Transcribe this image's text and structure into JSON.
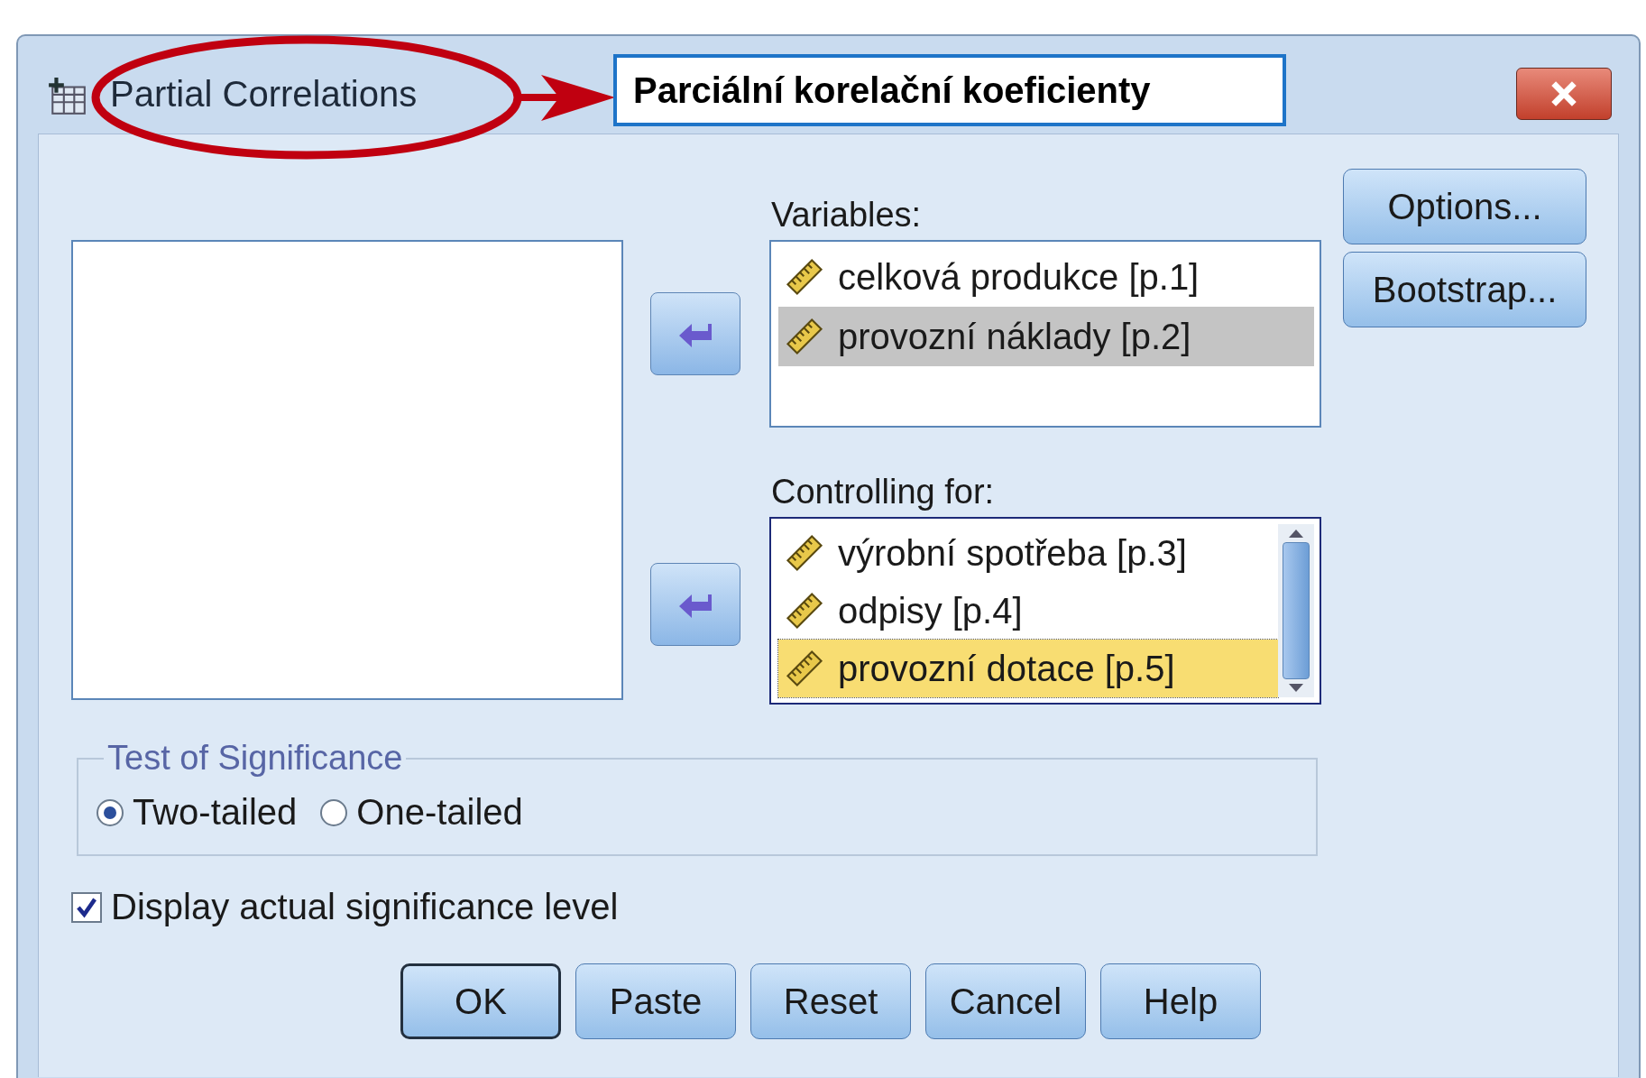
{
  "window": {
    "title": "Partial Correlations"
  },
  "annotation": {
    "label": "Parciální korelační koeficienty"
  },
  "variables": {
    "label": "Variables:",
    "focused": false,
    "items": [
      {
        "name": "celková produkce [p.1]",
        "selected": false
      },
      {
        "name": "provozní náklady [p.2]",
        "selected": true
      }
    ]
  },
  "controlling_for": {
    "label": "Controlling for:",
    "focused": true,
    "items": [
      {
        "name": "výrobní spotřeba [p.3]",
        "selected": false
      },
      {
        "name": "odpisy [p.4]",
        "selected": false
      },
      {
        "name": "provozní dotace [p.5]",
        "selected": true
      }
    ]
  },
  "side_buttons": [
    {
      "label": "Options..."
    },
    {
      "label": "Bootstrap..."
    }
  ],
  "test_of_significance": {
    "title": "Test of Significance",
    "options": [
      {
        "label": "Two-tailed",
        "selected": true
      },
      {
        "label": "One-tailed",
        "selected": false
      }
    ]
  },
  "display_actual_significance": {
    "label": "Display actual significance level",
    "checked": true
  },
  "buttons": [
    {
      "label": "OK",
      "default": true
    },
    {
      "label": "Paste",
      "default": false
    },
    {
      "label": "Reset",
      "default": false
    },
    {
      "label": "Cancel",
      "default": false
    },
    {
      "label": "Help",
      "default": false
    }
  ]
}
